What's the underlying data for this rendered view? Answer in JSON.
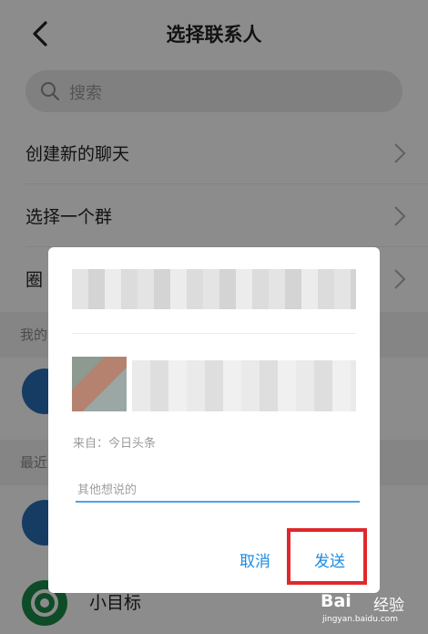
{
  "header": {
    "title": "选择联系人",
    "back_icon": "chevron-left-icon"
  },
  "search": {
    "placeholder": "搜索"
  },
  "menu": [
    {
      "label": "创建新的聊天"
    },
    {
      "label": "选择一个群"
    },
    {
      "label": "圈"
    }
  ],
  "sections": [
    {
      "label": "我的"
    },
    {
      "label": "最近"
    }
  ],
  "contacts": [
    {
      "name": "小目标",
      "avatar_color": "#1a8a4a"
    }
  ],
  "dialog": {
    "source": "来自：今日头条",
    "message_placeholder": "其他想说的",
    "cancel_label": "取消",
    "send_label": "发送",
    "accent": "#1e8be0",
    "highlight": "#e0282b"
  },
  "watermark": {
    "logo": "Bai",
    "text": "经验",
    "url": "jingyan.baidu.com"
  }
}
